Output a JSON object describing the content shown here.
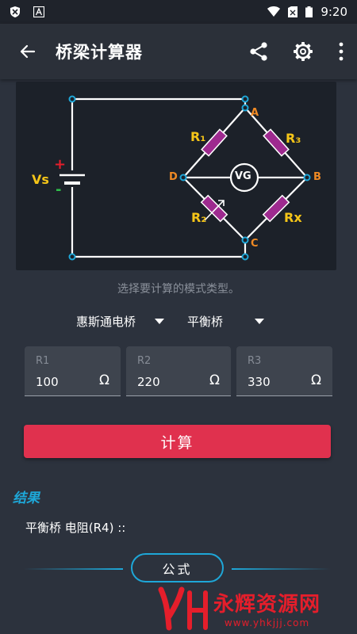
{
  "status_bar": {
    "time": "9:20"
  },
  "app_bar": {
    "title": "桥梁计算器"
  },
  "diagram": {
    "source_label": "Vs",
    "plus": "+",
    "minus": "-",
    "r1": "R₁",
    "r2": "R₂",
    "r3": "R₃",
    "rx": "Rx",
    "vg": "VG",
    "node_a": "A",
    "node_b": "B",
    "node_c": "C",
    "node_d": "D",
    "colors": {
      "resistor": "#9e2a8f",
      "label_yellow": "#f5c518",
      "node_orange": "#f08a24",
      "wire": "#ffffff"
    }
  },
  "hint": "选择要计算的模式类型。",
  "selects": {
    "bridge_type": "惠斯通电桥",
    "mode": "平衡桥"
  },
  "inputs": [
    {
      "label": "R1",
      "value": "100",
      "unit": "Ω"
    },
    {
      "label": "R2",
      "value": "220",
      "unit": "Ω"
    },
    {
      "label": "R3",
      "value": "330",
      "unit": "Ω"
    }
  ],
  "calc_button": "计算",
  "results": {
    "title": "结果",
    "line": "平衡桥 电阻(R4) ::"
  },
  "formula_button": "公式",
  "watermark": {
    "text": "永辉资源网",
    "url": "www.yhkjjj.com"
  }
}
